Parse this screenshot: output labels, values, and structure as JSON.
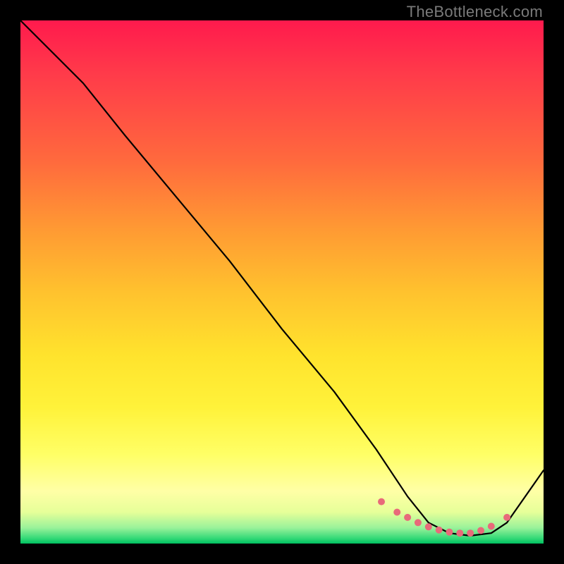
{
  "watermark": "TheBottleneck.com",
  "chart_data": {
    "type": "line",
    "title": "",
    "xlabel": "",
    "ylabel": "",
    "xlim": [
      0,
      100
    ],
    "ylim": [
      0,
      100
    ],
    "series": [
      {
        "name": "curve",
        "x": [
          0,
          7,
          12,
          20,
          30,
          40,
          50,
          60,
          68,
          74,
          78,
          82,
          86,
          90,
          93,
          100
        ],
        "y": [
          100,
          93,
          88,
          78,
          66,
          54,
          41,
          29,
          18,
          9,
          4,
          2,
          1.5,
          2,
          4,
          14
        ]
      }
    ],
    "markers": {
      "name": "trough-markers",
      "x": [
        69,
        72,
        74,
        76,
        78,
        80,
        82,
        84,
        86,
        88,
        90,
        93
      ],
      "y": [
        8,
        6,
        5,
        4,
        3.2,
        2.6,
        2.2,
        2,
        2,
        2.5,
        3.3,
        5
      ]
    },
    "gradient_stops": [
      {
        "pos": 0,
        "color": "#ff1a4d"
      },
      {
        "pos": 50,
        "color": "#ffcc2e"
      },
      {
        "pos": 85,
        "color": "#ffff80"
      },
      {
        "pos": 100,
        "color": "#00c060"
      }
    ]
  }
}
